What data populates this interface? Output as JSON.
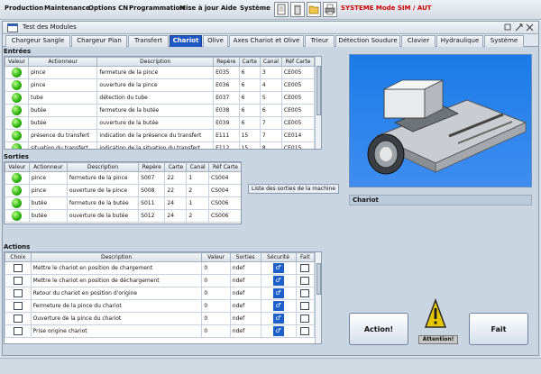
{
  "menubar": {
    "items": [
      "Production",
      "Maintenance",
      "Options CN",
      "Programmation",
      "Mise à jour",
      "Aide",
      "Système"
    ],
    "toolbar_icons": [
      "document-icon",
      "trash-icon",
      "folder-icon",
      "printer-icon"
    ],
    "system_mode": "SYSTEME Mode SIM / AUT"
  },
  "window": {
    "title": "Test des Modules",
    "tabs": [
      "Chargeur Sangle",
      "Chargeur Plan",
      "Transfert",
      "Chariot",
      "Olive",
      "Axes Chariot et Olive",
      "Trieur",
      "Détection Soudure",
      "Clavier",
      "Hydraulique",
      "Système"
    ],
    "active_tab": "Chariot"
  },
  "entrees": {
    "title": "Entrées",
    "columns": [
      "Valeur",
      "Actionneur",
      "Description",
      "Repère",
      "Carte",
      "Canal",
      "Réf Carte"
    ],
    "rows": [
      {
        "actionneur": "pince",
        "description": "fermeture de la pince",
        "repere": "E035",
        "carte": "6",
        "canal": "3",
        "ref": "CE005"
      },
      {
        "actionneur": "pince",
        "description": "ouverture de la pince",
        "repere": "E036",
        "carte": "6",
        "canal": "4",
        "ref": "CE005"
      },
      {
        "actionneur": "tube",
        "description": "détection du tube",
        "repere": "E037",
        "carte": "6",
        "canal": "5",
        "ref": "CE005"
      },
      {
        "actionneur": "butée",
        "description": "fermeture de la butée",
        "repere": "E038",
        "carte": "6",
        "canal": "6",
        "ref": "CE005"
      },
      {
        "actionneur": "butée",
        "description": "ouverture de la butée",
        "repere": "E039",
        "carte": "6",
        "canal": "7",
        "ref": "CE005"
      },
      {
        "actionneur": "présence du transfert",
        "description": "indication de la présence du transfert",
        "repere": "E111",
        "carte": "15",
        "canal": "7",
        "ref": "CE014"
      },
      {
        "actionneur": "situation du transfert",
        "description": "indication de la situation du transfert",
        "repere": "E112",
        "carte": "15",
        "canal": "8",
        "ref": "CE015"
      }
    ]
  },
  "sorties": {
    "title": "Sorties",
    "columns": [
      "Valeur",
      "Actionneur",
      "Description",
      "Repère",
      "Carte",
      "Canal",
      "Réf Carte"
    ],
    "rows": [
      {
        "actionneur": "pince",
        "description": "fermeture  de la  pince",
        "repere": "S007",
        "carte": "22",
        "canal": "1",
        "ref": "CS004"
      },
      {
        "actionneur": "pince",
        "description": "ouverture  de la  pince",
        "repere": "S008",
        "carte": "22",
        "canal": "2",
        "ref": "CS004"
      },
      {
        "actionneur": "butée",
        "description": "fermeture  de la  butée",
        "repere": "S011",
        "carte": "24",
        "canal": "1",
        "ref": "CS006"
      },
      {
        "actionneur": "butée",
        "description": "ouverture  de la  butée",
        "repere": "S012",
        "carte": "24",
        "canal": "2",
        "ref": "CS006"
      }
    ],
    "tooltip": "Liste des sorties de la machine"
  },
  "actions": {
    "title": "Actions",
    "columns": [
      "Choix",
      "Description",
      "Valeur",
      "Sorties",
      "Sécurité",
      "Fait"
    ],
    "rows": [
      {
        "description": "Mettre le chariot en position de chargement",
        "valeur": "0",
        "sorties": "ndef"
      },
      {
        "description": "Mettre le chariot en position de déchargement",
        "valeur": "0",
        "sorties": "ndef"
      },
      {
        "description": "Retour du chariot en position d'origine",
        "valeur": "0",
        "sorties": "ndef"
      },
      {
        "description": "Fermeture de la pince du chariot",
        "valeur": "0",
        "sorties": "ndef"
      },
      {
        "description": "Ouverture de la pince du chariot",
        "valeur": "0",
        "sorties": "ndef"
      },
      {
        "description": "Prise origine chariot",
        "valeur": "0",
        "sorties": "ndef"
      }
    ]
  },
  "right_panel": {
    "module_label": "Chariot",
    "action_button": "Action!",
    "done_button": "Fait",
    "attention_label": "Attention!",
    "warning_icon": "warning-triangle-icon"
  },
  "colors": {
    "active_tab": "#1f57c4",
    "system_mode_text": "#cc0000",
    "image_background": "#2a84ee",
    "led_on": "#2fb40f"
  }
}
